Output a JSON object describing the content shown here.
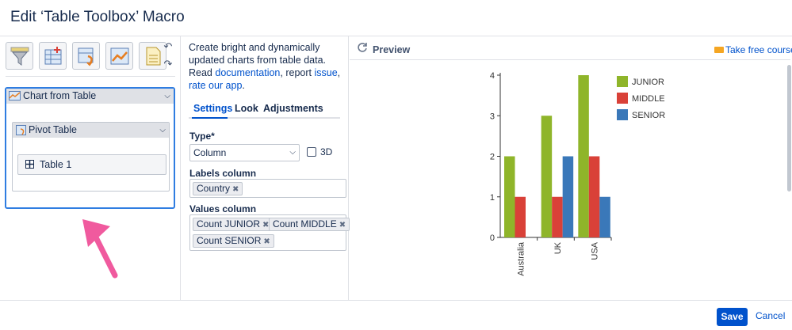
{
  "dialog": {
    "title": "Edit ‘Table Toolbox’ Macro"
  },
  "toolbar": {
    "tools": [
      {
        "icon": "filter-icon"
      },
      {
        "icon": "add-column-icon"
      },
      {
        "icon": "transform-icon"
      },
      {
        "icon": "chart-icon"
      },
      {
        "icon": "document-icon"
      }
    ],
    "undo_icon": "undo-icon",
    "redo_icon": "redo-icon"
  },
  "tree": {
    "chart": {
      "label": "Chart from Table"
    },
    "pivot": {
      "label": "Pivot Table"
    },
    "table": {
      "label": "Table 1"
    }
  },
  "description": {
    "text1": "Create bright and dynamically updated charts from table data.",
    "read": "Read",
    "documentation_link": "documentation",
    "comma_report": ", report",
    "issue_link": "issue",
    "comma": ",",
    "rate_link": "rate our app",
    "period": "."
  },
  "tabs": [
    {
      "label": "Settings",
      "active": true
    },
    {
      "label": "Look",
      "active": false
    },
    {
      "label": "Adjustments",
      "active": false
    }
  ],
  "settings": {
    "type_label": "Type*",
    "type_value": "Column",
    "three_d_label": "3D",
    "three_d_checked": false,
    "labels_column_label": "Labels column",
    "labels_column_chips": [
      "Country"
    ],
    "values_column_label": "Values column",
    "values_column_chips": [
      "Count JUNIOR",
      "Count MIDDLE",
      "Count SENIOR"
    ]
  },
  "preview": {
    "title": "Preview",
    "course_link": "Take free course"
  },
  "chart_data": {
    "type": "bar",
    "categories": [
      "Australia",
      "UK",
      "USA"
    ],
    "series": [
      {
        "name": "JUNIOR",
        "values": [
          2,
          3,
          4
        ],
        "color": "#8fb52a"
      },
      {
        "name": "MIDDLE",
        "values": [
          1,
          1,
          2
        ],
        "color": "#d94138"
      },
      {
        "name": "SENIOR",
        "values": [
          0,
          2,
          1
        ],
        "color": "#3a78b9"
      }
    ],
    "ylim": [
      0,
      4
    ],
    "yticks": [
      "0",
      "1",
      "2",
      "3",
      "4"
    ],
    "legend": "right",
    "grid": false
  },
  "footer": {
    "save_label": "Save",
    "cancel_label": "Cancel"
  },
  "annotation": {
    "color": "#f05a9e",
    "icon": "pink-arrow"
  }
}
